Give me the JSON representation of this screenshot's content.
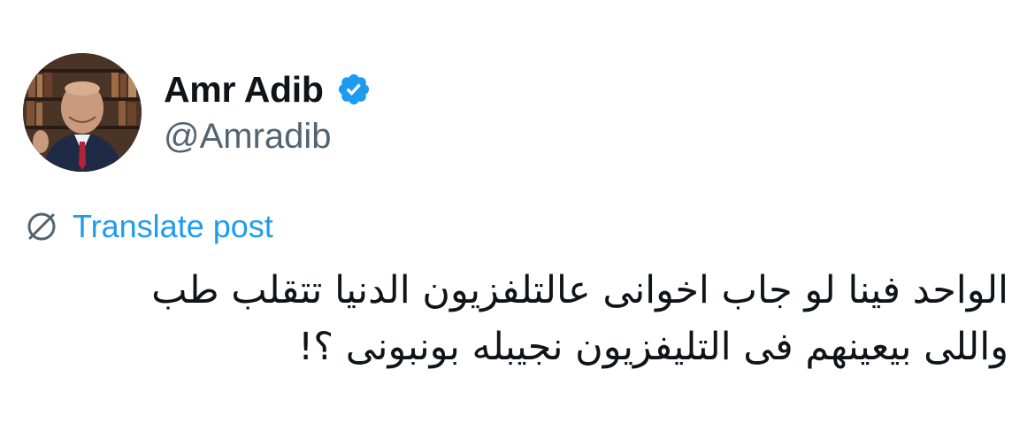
{
  "author": {
    "display_name": "Amr Adib",
    "handle": "@Amradib",
    "verified": true,
    "verified_icon": "verified-badge-icon",
    "verified_color": "#1d9bf0",
    "avatar": "profile-photo"
  },
  "translate": {
    "label": "Translate post",
    "icon": "translate-globe-icon",
    "color": "#1d9bf0"
  },
  "post": {
    "lines": [
      "الواحد فينا لو جاب اخوانى عالتلفزيون الدنيا تتقلب طب",
      "واللى بيعينهم فى التليفزيون نجيبله بونبونى ؟!"
    ]
  },
  "colors": {
    "text_primary": "#0f1419",
    "text_secondary": "#536471",
    "accent": "#1d9bf0",
    "background": "#ffffff"
  }
}
